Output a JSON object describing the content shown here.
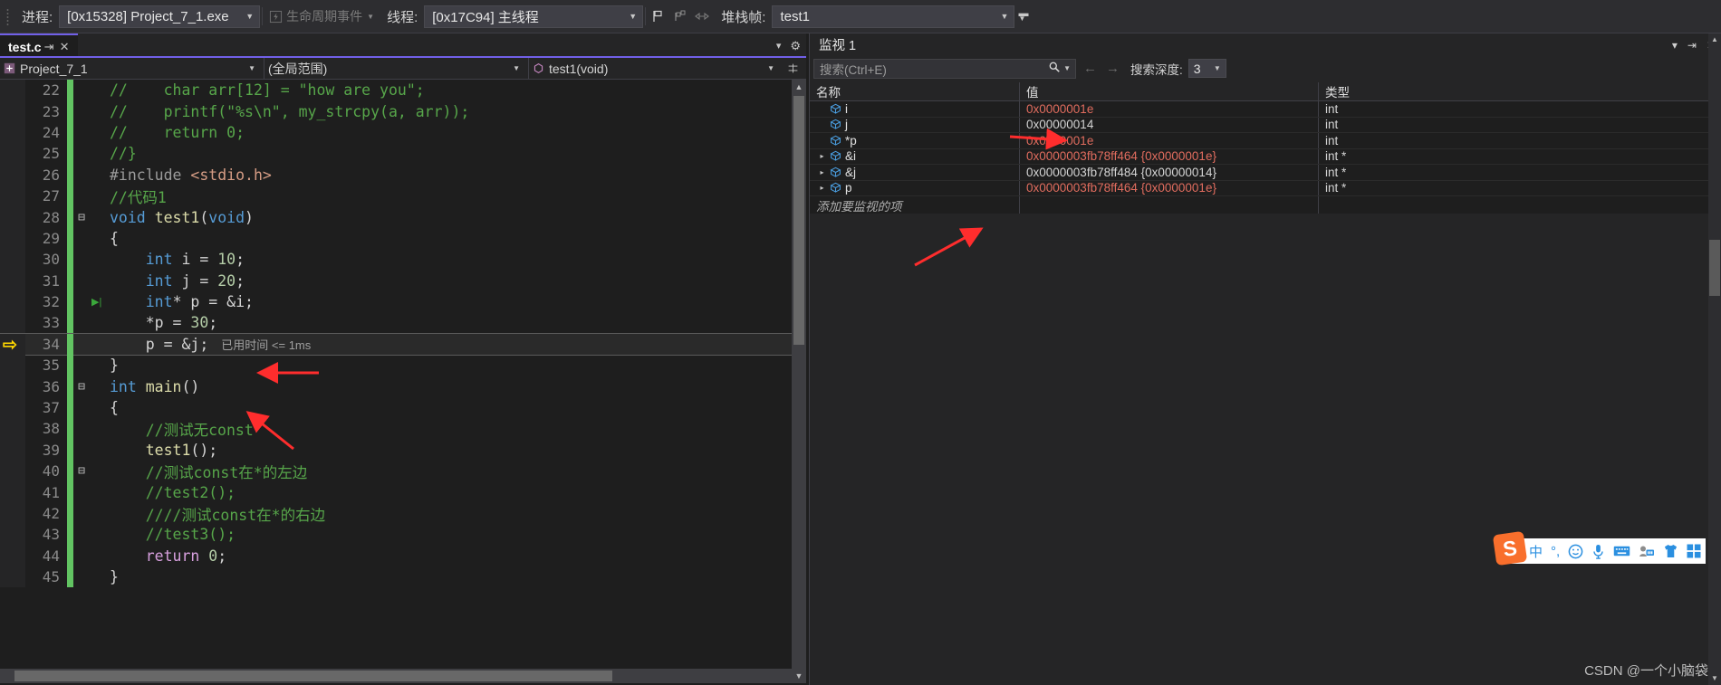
{
  "debug_toolbar": {
    "process_label": "进程:",
    "process_value": "[0x15328] Project_7_1.exe",
    "lifecycle_label": "生命周期事件",
    "thread_label": "线程:",
    "thread_value": "[0x17C94] 主线程",
    "stackframe_label": "堆栈帧:",
    "stackframe_value": "test1"
  },
  "editor": {
    "tab_title": "test.c",
    "nav_project": "Project_7_1",
    "nav_scope": "(全局范围)",
    "nav_function": "test1(void)",
    "elapsed_text": "已用时间 <= 1ms",
    "lines": [
      {
        "n": "22",
        "indent": 0,
        "mod": true,
        "fold": "",
        "html": "<span class='cm'>//    char arr[12] = \"how are you\";</span>"
      },
      {
        "n": "23",
        "indent": 0,
        "mod": true,
        "fold": "",
        "html": "<span class='cm'>//    printf(\"%s\\n\", my_strcpy(a, arr));</span>"
      },
      {
        "n": "24",
        "indent": 0,
        "mod": true,
        "fold": "",
        "html": "<span class='cm'>//    return 0;</span>"
      },
      {
        "n": "25",
        "indent": 0,
        "mod": true,
        "fold": "",
        "html": "<span class='cm'>//}</span>"
      },
      {
        "n": "26",
        "indent": 0,
        "mod": true,
        "fold": "",
        "html": "<span class='pre'>#include </span><span class='inc'>&lt;stdio.h&gt;</span>"
      },
      {
        "n": "27",
        "indent": 0,
        "mod": true,
        "fold": "",
        "html": "<span class='cm'>//代码1</span>"
      },
      {
        "n": "28",
        "indent": 0,
        "mod": true,
        "fold": "minus",
        "html": "<span class='kw'>void</span> <span class='fn'>test1</span><span class='pln'>(</span><span class='kw'>void</span><span class='pln'>)</span>"
      },
      {
        "n": "29",
        "indent": 0,
        "mod": true,
        "fold": "",
        "html": "<span class='pln'>{</span>"
      },
      {
        "n": "30",
        "indent": 0,
        "mod": true,
        "fold": "",
        "html": "    <span class='kw'>int</span> i = <span class='num'>10</span>;"
      },
      {
        "n": "31",
        "indent": 0,
        "mod": true,
        "fold": "",
        "html": "    <span class='kw'>int</span> j = <span class='num'>20</span>;"
      },
      {
        "n": "32",
        "indent": 0,
        "mod": true,
        "fold": "",
        "bp": true,
        "html": "    <span class='kw'>int</span>* p = &amp;i;"
      },
      {
        "n": "33",
        "indent": 0,
        "mod": true,
        "fold": "",
        "html": "    *p = <span class='num'>30</span>;"
      },
      {
        "n": "34",
        "indent": 0,
        "mod": true,
        "fold": "",
        "exec": true,
        "html": "    p = &amp;j;"
      },
      {
        "n": "35",
        "indent": 0,
        "mod": true,
        "fold": "",
        "html": "<span class='pln'>}</span>"
      },
      {
        "n": "36",
        "indent": 0,
        "mod": true,
        "fold": "minus",
        "html": "<span class='kw'>int</span> <span class='fn'>main</span><span class='pln'>()</span>"
      },
      {
        "n": "37",
        "indent": 0,
        "mod": true,
        "fold": "",
        "html": "<span class='pln'>{</span>"
      },
      {
        "n": "38",
        "indent": 0,
        "mod": true,
        "fold": "",
        "html": "    <span class='cm'>//测试无const</span>"
      },
      {
        "n": "39",
        "indent": 0,
        "mod": true,
        "fold": "",
        "html": "    <span class='fn'>test1</span><span class='pln'>();</span>"
      },
      {
        "n": "40",
        "indent": 0,
        "mod": true,
        "fold": "minus",
        "html": "    <span class='cm'>//测试const在*的左边</span>"
      },
      {
        "n": "41",
        "indent": 0,
        "mod": true,
        "fold": "",
        "html": "    <span class='cm'>//test2();</span>"
      },
      {
        "n": "42",
        "indent": 0,
        "mod": true,
        "fold": "",
        "html": "    <span class='cm'>////测试const在*的右边</span>"
      },
      {
        "n": "43",
        "indent": 0,
        "mod": true,
        "fold": "",
        "html": "    <span class='cm'>//test3();</span>"
      },
      {
        "n": "44",
        "indent": 0,
        "mod": true,
        "fold": "",
        "html": "    <span class='ctl'>return</span> <span class='num'>0</span>;"
      },
      {
        "n": "45",
        "indent": 0,
        "mod": true,
        "fold": "",
        "html": "<span class='pln'>}</span>"
      }
    ]
  },
  "watch": {
    "title": "监视 1",
    "search_placeholder": "搜索(Ctrl+E)",
    "depth_label": "搜索深度:",
    "depth_value": "3",
    "columns": {
      "name": "名称",
      "value": "值",
      "type": "类型"
    },
    "add_row_text": "添加要监视的项",
    "rows": [
      {
        "expandable": false,
        "name": "i",
        "value": "0x0000001e",
        "type": "int",
        "changed": true
      },
      {
        "expandable": false,
        "name": "j",
        "value": "0x00000014",
        "type": "int",
        "changed": false
      },
      {
        "expandable": false,
        "name": "*p",
        "value": "0x0000001e",
        "type": "int",
        "changed": true
      },
      {
        "expandable": true,
        "name": "&i",
        "value": "0x0000003fb78ff464 {0x0000001e}",
        "type": "int *",
        "changed": true
      },
      {
        "expandable": true,
        "name": "&j",
        "value": "0x0000003fb78ff484 {0x00000014}",
        "type": "int *",
        "changed": false
      },
      {
        "expandable": true,
        "name": "p",
        "value": "0x0000003fb78ff464 {0x0000001e}",
        "type": "int *",
        "changed": true
      }
    ]
  },
  "ime": {
    "logo_text": "S",
    "items": [
      "中",
      "°,",
      "☺",
      "🎤",
      "⌨",
      "👤",
      "👕",
      "▦"
    ]
  },
  "watermark": "CSDN @一个小脑袋",
  "colors": {
    "accent_tab": "#7160e8",
    "changebar_modified": "#62c462",
    "value_changed": "#e06c5e",
    "annotation_arrow": "#ff2d2d"
  }
}
